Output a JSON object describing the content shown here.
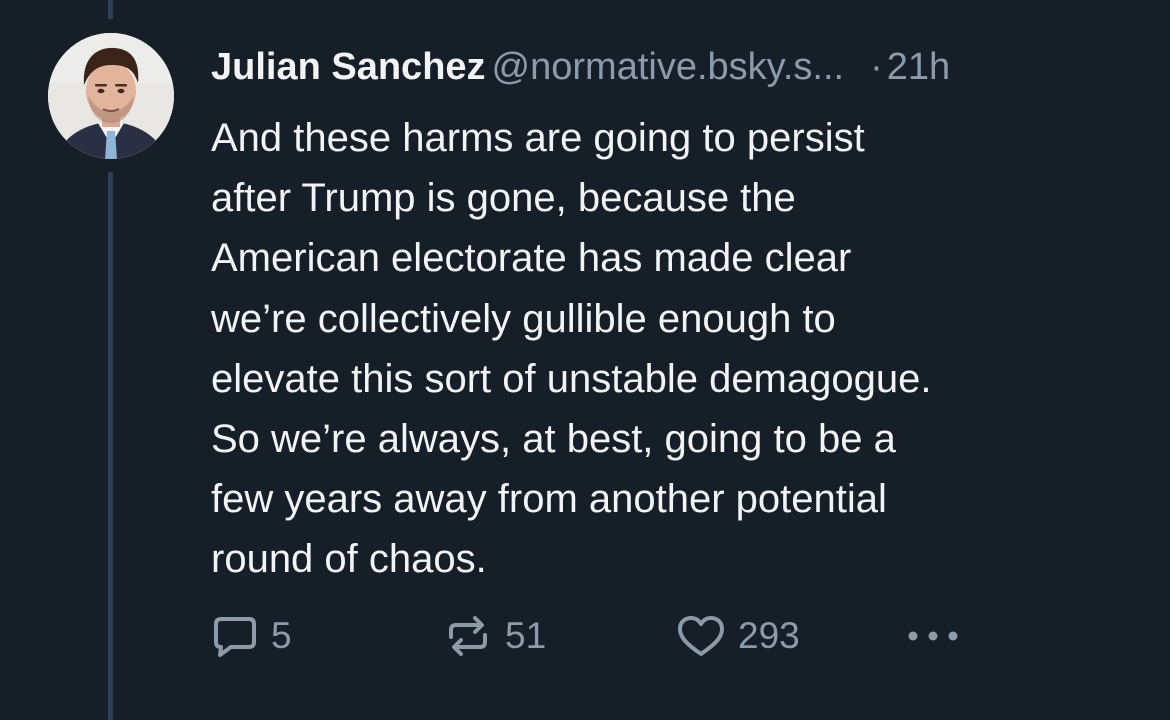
{
  "post": {
    "author": {
      "display_name": "Julian Sanchez",
      "handle": "@normative.bsky.s...",
      "avatar_icon": "profile-photo"
    },
    "separator": "·",
    "timestamp": "21h",
    "text_lines": [
      "And these harms are going to persist",
      "after Trump is gone, because the",
      "American electorate has made clear",
      "we’re collectively gullible enough to",
      "elevate this sort of unstable demagogue.",
      "So we’re always, at best, going to be a",
      "few years away from another potential",
      "round of chaos."
    ],
    "actions": {
      "reply": {
        "icon": "reply-bubble-icon",
        "count": "5"
      },
      "repost": {
        "icon": "repost-arrows-icon",
        "count": "51"
      },
      "like": {
        "icon": "heart-icon",
        "count": "293"
      },
      "more": {
        "icon": "ellipsis-icon"
      }
    }
  },
  "colors": {
    "background": "#161e27",
    "text_primary": "#f1f3f5",
    "text_secondary": "#8d9aa8",
    "thread_line": "#2e4052"
  }
}
